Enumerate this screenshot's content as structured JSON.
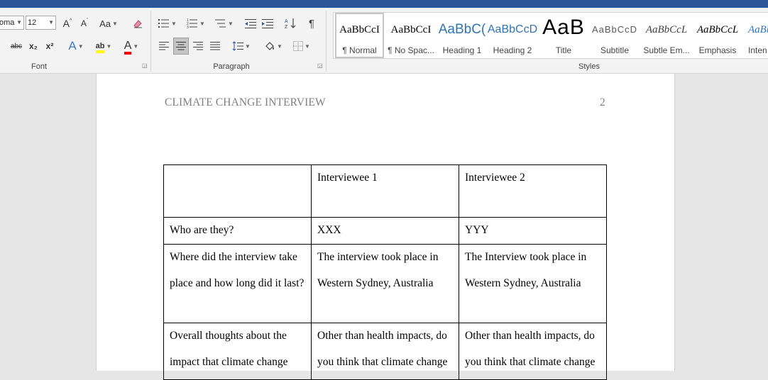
{
  "ribbon": {
    "font": {
      "font_name": "oma",
      "font_size": "12",
      "grow_label": "A",
      "shrink_label": "A",
      "change_case_label": "Aa",
      "strike_label": "abc",
      "sub_label": "x₂",
      "sup_label": "x²",
      "text_effects_label": "A",
      "highlight_label": "ab",
      "font_color_label": "A",
      "group_label": "Font"
    },
    "paragraph": {
      "pilcrow": "¶",
      "group_label": "Paragraph"
    },
    "styles": {
      "group_label": "Styles",
      "items": [
        {
          "preview": "AaBbCcI",
          "name": "¶ Normal"
        },
        {
          "preview": "AaBbCcI",
          "name": "¶ No Spac..."
        },
        {
          "preview": "AaBbC(",
          "name": "Heading 1"
        },
        {
          "preview": "AaBbCcD",
          "name": "Heading 2"
        },
        {
          "preview": "AaB",
          "name": "Title"
        },
        {
          "preview": "AaBbCcD",
          "name": "Subtitle"
        },
        {
          "preview": "AaBbCcL",
          "name": "Subtle Em..."
        },
        {
          "preview": "AaBbCcL",
          "name": "Emphasis"
        },
        {
          "preview": "AaBb",
          "name": "Inten"
        }
      ]
    }
  },
  "colors": {
    "accent": "#2b579a",
    "heading_blue": "#2e74b5",
    "highlight": "#ffff00",
    "font_red": "#ff0000"
  },
  "document": {
    "header_title": "CLIMATE CHANGE INTERVIEW",
    "page_number": "2",
    "table": {
      "header": [
        "",
        "Interviewee 1",
        "Interviewee 2"
      ],
      "rows": [
        [
          "Who are they?",
          "XXX",
          "YYY"
        ],
        [
          "Where did the interview take place and how long did it last?",
          "The interview took place in Western Sydney, Australia",
          "The Interview took place in Western Sydney, Australia"
        ],
        [
          "Overall thoughts about the impact that climate change",
          "Other than health impacts, do you think that climate change",
          "Other than health impacts, do you think that climate change"
        ]
      ]
    }
  }
}
